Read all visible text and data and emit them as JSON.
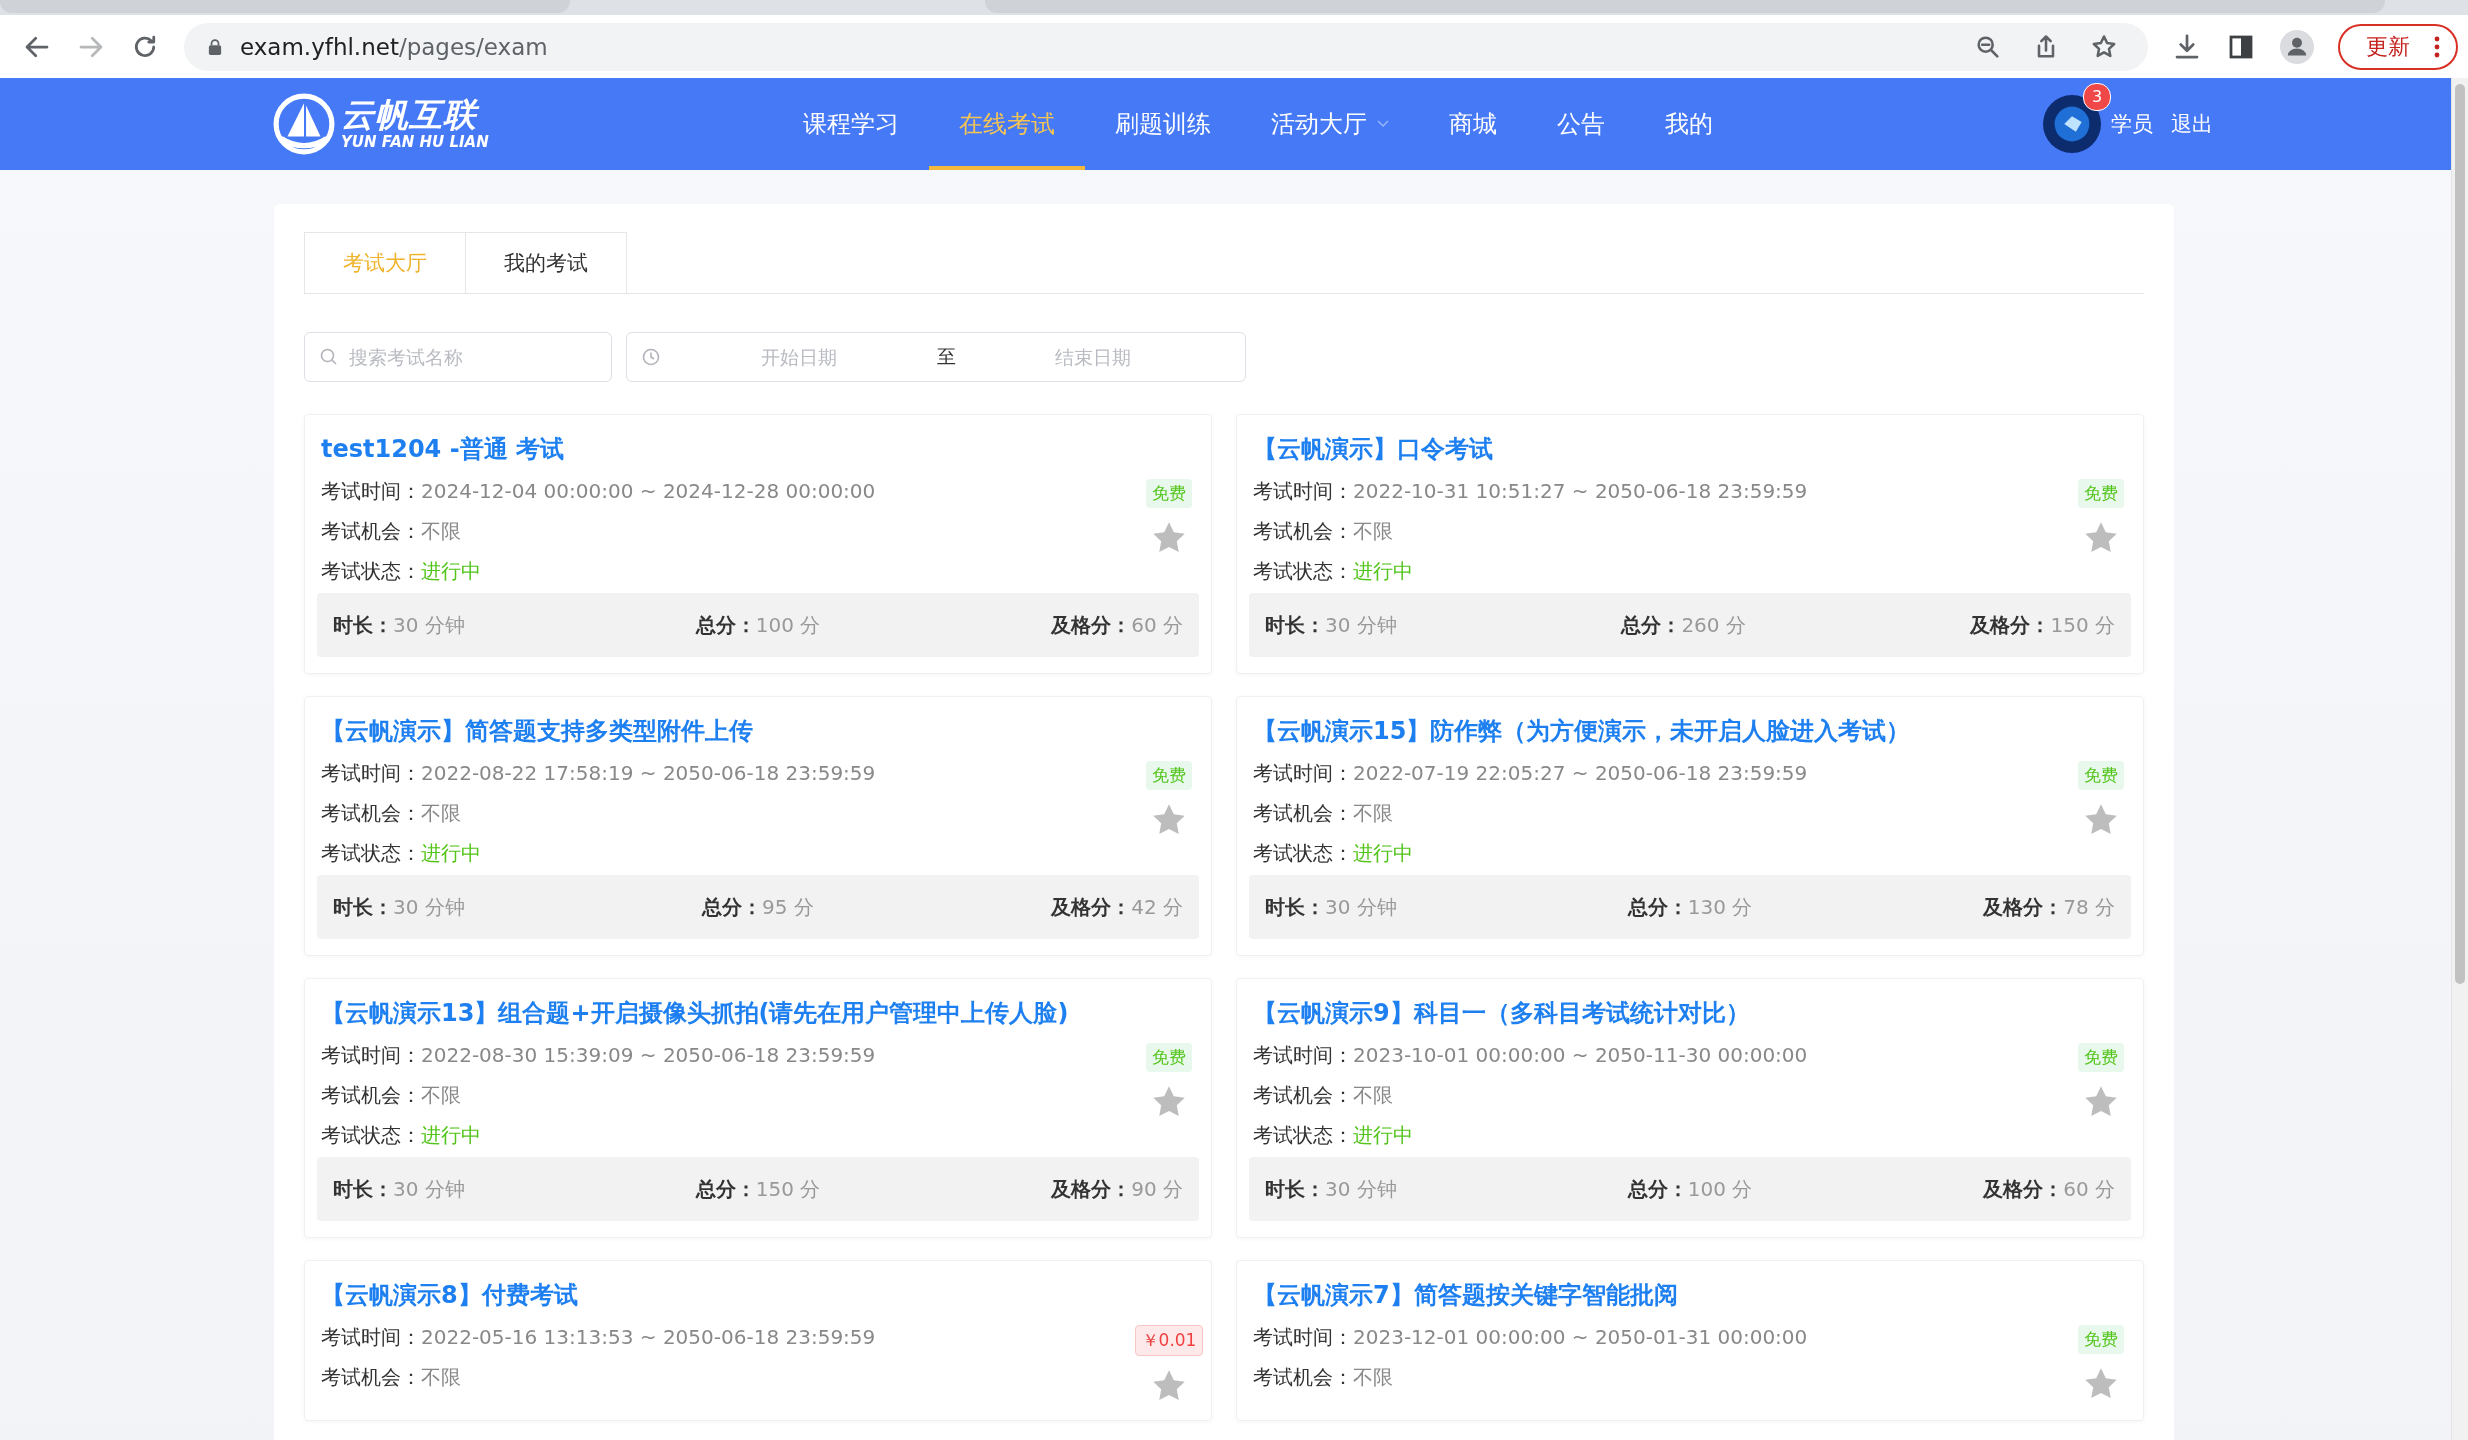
{
  "browser": {
    "url_host": "exam.yfhl.net",
    "url_path": "/pages/exam",
    "update_button": "更新"
  },
  "nav": {
    "logo_cn": "云帆互联",
    "logo_en": "YUN FAN HU LIAN",
    "items": [
      {
        "label": "课程学习",
        "selected": false,
        "dropdown": false
      },
      {
        "label": "在线考试",
        "selected": true,
        "dropdown": false
      },
      {
        "label": "刷题训练",
        "selected": false,
        "dropdown": false
      },
      {
        "label": "活动大厅",
        "selected": false,
        "dropdown": true
      },
      {
        "label": "商城",
        "selected": false,
        "dropdown": false
      },
      {
        "label": "公告",
        "selected": false,
        "dropdown": false
      },
      {
        "label": "我的",
        "selected": false,
        "dropdown": false
      }
    ],
    "badge": "3",
    "user": "学员",
    "logout": "退出"
  },
  "tabs": [
    {
      "label": "考试大厅",
      "selected": true
    },
    {
      "label": "我的考试",
      "selected": false
    }
  ],
  "search": {
    "placeholder": "搜索考试名称"
  },
  "date_range": {
    "start_placeholder": "开始日期",
    "separator": "至",
    "end_placeholder": "结束日期"
  },
  "exams": [
    {
      "title": "test1204 -普通 考试",
      "time_label": "考试时间：",
      "time": "2024-12-04 00:00:00 ~ 2024-12-28 00:00:00",
      "chance_label": "考试机会：",
      "chance": "不限",
      "status_label": "考试状态：",
      "status": "进行中",
      "price": {
        "text": "免费",
        "kind": "free"
      },
      "stats": [
        {
          "label": "时长：",
          "value": "30 分钟"
        },
        {
          "label": "总分：",
          "value": "100 分"
        },
        {
          "label": "及格分：",
          "value": "60 分"
        }
      ]
    },
    {
      "title": "【云帆演示】口令考试",
      "time_label": "考试时间：",
      "time": "2022-10-31 10:51:27 ~ 2050-06-18 23:59:59",
      "chance_label": "考试机会：",
      "chance": "不限",
      "status_label": "考试状态：",
      "status": "进行中",
      "price": {
        "text": "免费",
        "kind": "free"
      },
      "stats": [
        {
          "label": "时长：",
          "value": "30 分钟"
        },
        {
          "label": "总分：",
          "value": "260 分"
        },
        {
          "label": "及格分：",
          "value": "150 分"
        }
      ]
    },
    {
      "title": "【云帆演示】简答题支持多类型附件上传",
      "time_label": "考试时间：",
      "time": "2022-08-22 17:58:19 ~ 2050-06-18 23:59:59",
      "chance_label": "考试机会：",
      "chance": "不限",
      "status_label": "考试状态：",
      "status": "进行中",
      "price": {
        "text": "免费",
        "kind": "free"
      },
      "stats": [
        {
          "label": "时长：",
          "value": "30 分钟"
        },
        {
          "label": "总分：",
          "value": "95 分"
        },
        {
          "label": "及格分：",
          "value": "42 分"
        }
      ]
    },
    {
      "title": "【云帆演示15】防作弊（为方便演示，未开启人脸进入考试）",
      "time_label": "考试时间：",
      "time": "2022-07-19 22:05:27 ~ 2050-06-18 23:59:59",
      "chance_label": "考试机会：",
      "chance": "不限",
      "status_label": "考试状态：",
      "status": "进行中",
      "price": {
        "text": "免费",
        "kind": "free"
      },
      "stats": [
        {
          "label": "时长：",
          "value": "30 分钟"
        },
        {
          "label": "总分：",
          "value": "130 分"
        },
        {
          "label": "及格分：",
          "value": "78 分"
        }
      ]
    },
    {
      "title": "【云帆演示13】组合题+开启摄像头抓拍(请先在用户管理中上传人脸)",
      "time_label": "考试时间：",
      "time": "2022-08-30 15:39:09 ~ 2050-06-18 23:59:59",
      "chance_label": "考试机会：",
      "chance": "不限",
      "status_label": "考试状态：",
      "status": "进行中",
      "price": {
        "text": "免费",
        "kind": "free"
      },
      "stats": [
        {
          "label": "时长：",
          "value": "30 分钟"
        },
        {
          "label": "总分：",
          "value": "150 分"
        },
        {
          "label": "及格分：",
          "value": "90 分"
        }
      ]
    },
    {
      "title": "【云帆演示9】科目一（多科目考试统计对比）",
      "time_label": "考试时间：",
      "time": "2023-10-01 00:00:00 ~ 2050-11-30 00:00:00",
      "chance_label": "考试机会：",
      "chance": "不限",
      "status_label": "考试状态：",
      "status": "进行中",
      "price": {
        "text": "免费",
        "kind": "free"
      },
      "stats": [
        {
          "label": "时长：",
          "value": "30 分钟"
        },
        {
          "label": "总分：",
          "value": "100 分"
        },
        {
          "label": "及格分：",
          "value": "60 分"
        }
      ]
    },
    {
      "title": "【云帆演示8】付费考试",
      "time_label": "考试时间：",
      "time": "2022-05-16 13:13:53 ~ 2050-06-18 23:59:59",
      "chance_label": "考试机会：",
      "chance": "不限",
      "price": {
        "text": "￥0.01",
        "kind": "paid"
      }
    },
    {
      "title": "【云帆演示7】简答题按关键字智能批阅",
      "time_label": "考试时间：",
      "time": "2023-12-01 00:00:00 ~ 2050-01-31 00:00:00",
      "chance_label": "考试机会：",
      "chance": "不限",
      "price": {
        "text": "免费",
        "kind": "free"
      }
    }
  ]
}
